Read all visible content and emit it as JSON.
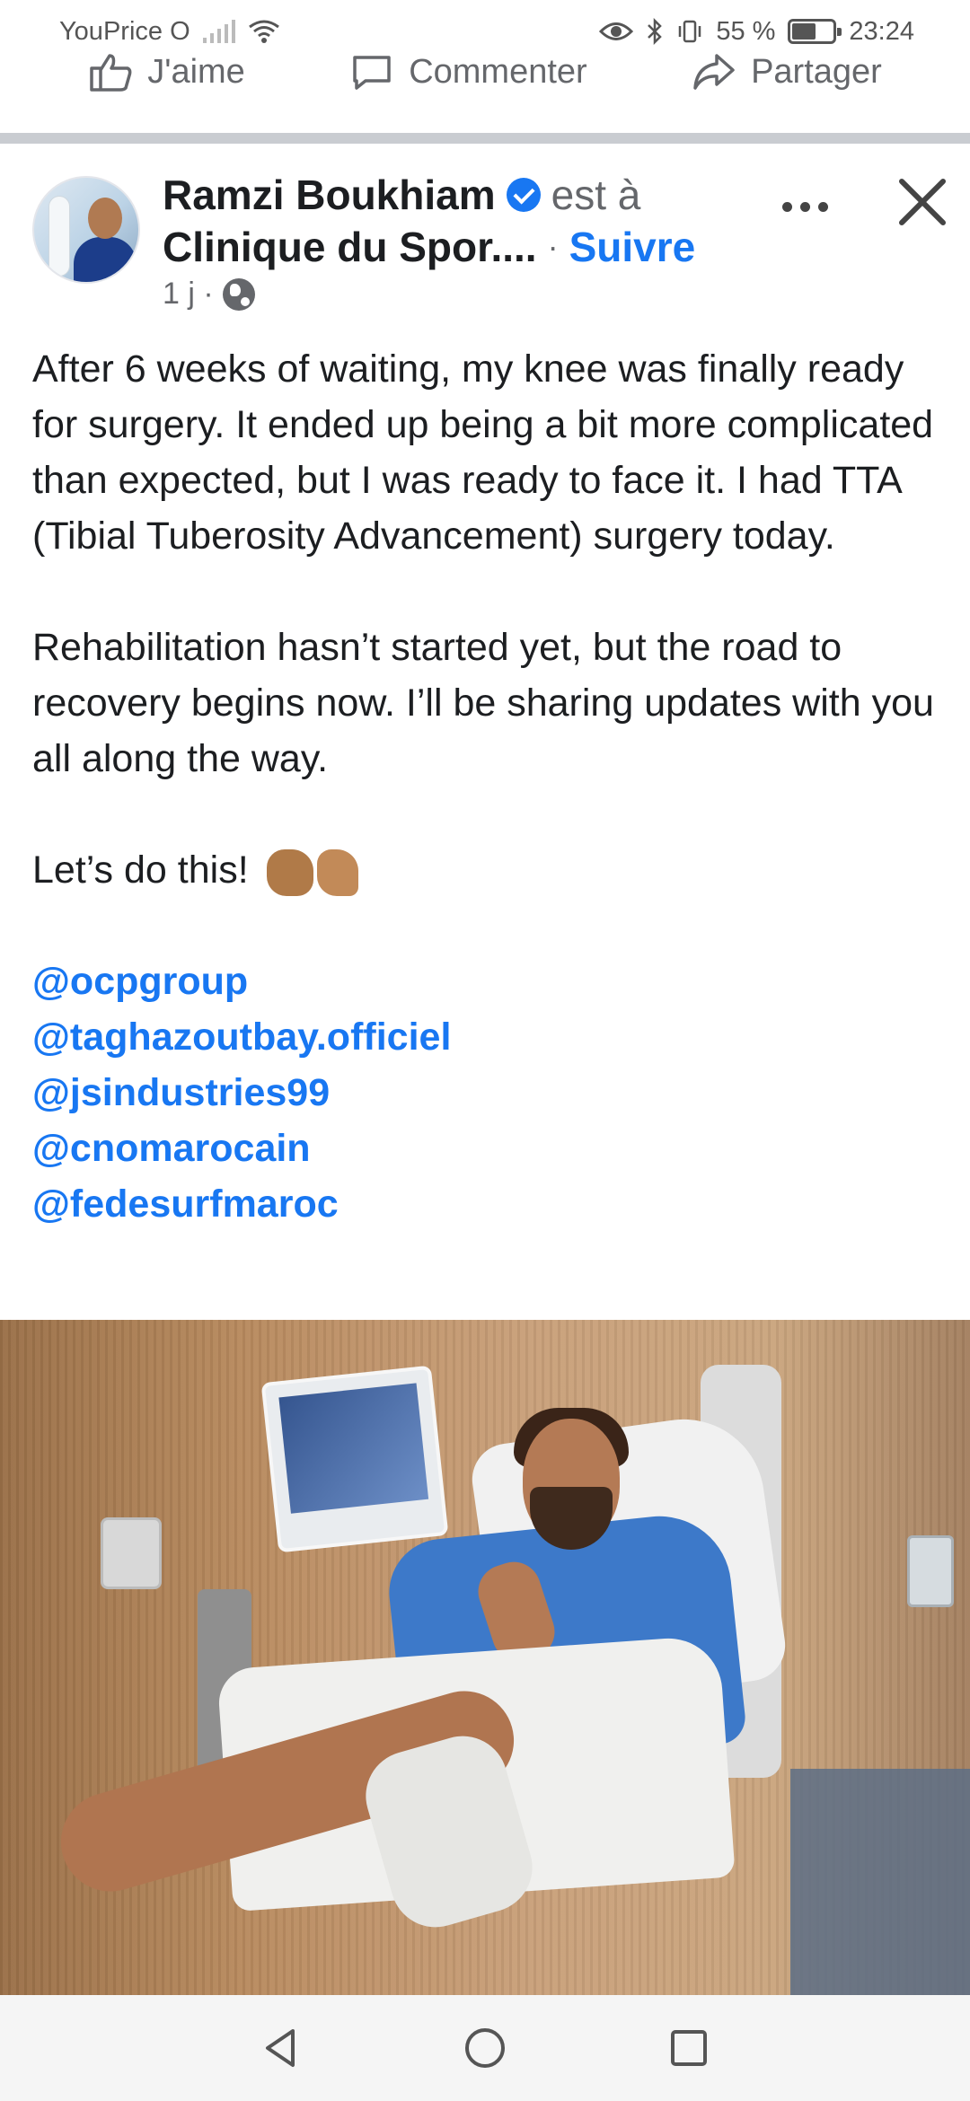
{
  "status_bar": {
    "carrier": "YouPrice O",
    "battery_percent": "55 %",
    "time": "23:24"
  },
  "actions": {
    "like": "J'aime",
    "comment": "Commenter",
    "share": "Partager"
  },
  "post": {
    "author": "Ramzi Boukhiam",
    "is_at_text": "est à",
    "location": "Clinique du Spor....",
    "follow_label": "Suivre",
    "timestamp": "1 j ·",
    "paragraphs": [
      "After 6 weeks of waiting, my knee was finally ready for surgery. It ended up being a bit more complicated than expected, but I was ready to face it. I had TTA (Tibial Tuberosity Advancement) surgery today.",
      "Rehabilitation hasn’t started yet, but the road to recovery begins now. I’ll be sharing updates with you all along the way.",
      "Let’s do this!"
    ],
    "mentions": [
      "@ocpgroup",
      "@taghazoutbay.officiel",
      "@jsindustries99",
      "@cnomarocain",
      "@fedesurfmaroc"
    ]
  },
  "colors": {
    "link_blue": "#1877f2",
    "text_dark": "#1c1e21",
    "muted_gray": "#65676b"
  },
  "icons": {
    "like": "thumbs-up-icon",
    "comment": "comment-icon",
    "share": "share-icon",
    "verified": "verified-badge-icon",
    "privacy": "globe-icon",
    "more": "more-options-icon",
    "close": "close-icon",
    "nav_back": "back-triangle-icon",
    "nav_home": "home-circle-icon",
    "nav_recents": "recents-square-icon"
  }
}
